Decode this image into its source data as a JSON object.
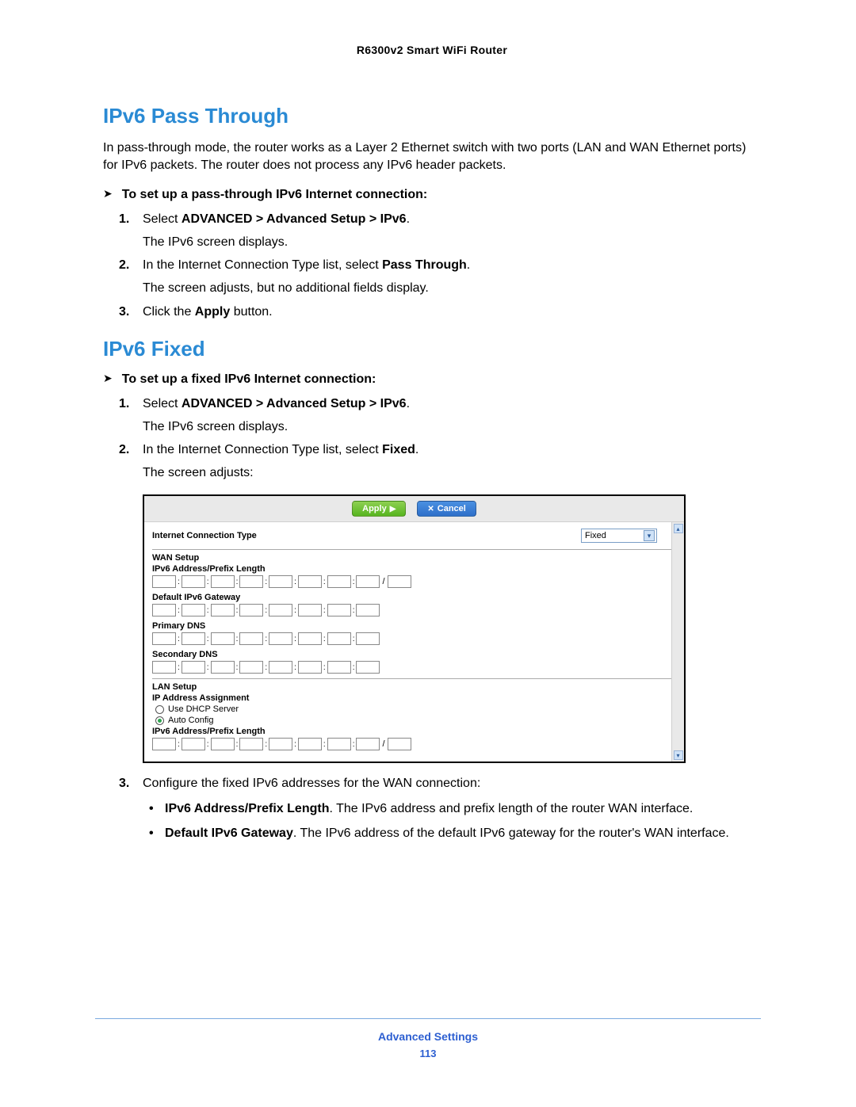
{
  "header": {
    "title": "R6300v2 Smart WiFi Router"
  },
  "sections": {
    "s1_title": "IPv6 Pass Through",
    "s1_body": "In pass-through mode, the router works as a Layer 2 Ethernet switch with two ports (LAN and WAN Ethernet ports) for IPv6 packets. The router does not process any IPv6 header packets.",
    "s1_proc_head": "To set up a pass-through IPv6 Internet connection:",
    "s1_steps": [
      {
        "num": "1.",
        "prefix": "Select ",
        "bold": "ADVANCED > Advanced Setup > IPv6",
        "suffix": ".",
        "sub": "The IPv6 screen displays."
      },
      {
        "num": "2.",
        "prefix": "In the Internet Connection Type list, select ",
        "bold": "Pass Through",
        "suffix": ".",
        "sub": "The screen adjusts, but no additional fields display."
      },
      {
        "num": "3.",
        "prefix": "Click the ",
        "bold": "Apply",
        "suffix": " button.",
        "sub": ""
      }
    ],
    "s2_title": "IPv6 Fixed",
    "s2_proc_head": "To set up a fixed IPv6 Internet connection:",
    "s2_steps": [
      {
        "num": "1.",
        "prefix": "Select ",
        "bold": "ADVANCED > Advanced Setup > IPv6",
        "suffix": ".",
        "sub": "The IPv6 screen displays."
      },
      {
        "num": "2.",
        "prefix": "In the Internet Connection Type list, select ",
        "bold": "Fixed",
        "suffix": ".",
        "sub": "The screen adjusts:"
      }
    ],
    "s2_step3": {
      "num": "3.",
      "text": "Configure the fixed IPv6 addresses for the WAN connection:"
    },
    "s2_bullets": [
      {
        "bold": "IPv6 Address/Prefix Length",
        "text": ". The IPv6 address and prefix length of the router WAN interface."
      },
      {
        "bold": "Default IPv6 Gateway",
        "text": ". The IPv6 address of the default IPv6 gateway for the router's WAN interface."
      }
    ]
  },
  "ui": {
    "apply_label": "Apply",
    "cancel_label": "Cancel",
    "apply_glyph": "▶",
    "cancel_glyph": "✕",
    "conn_label": "Internet Connection Type",
    "conn_value": "Fixed",
    "wan_title": "WAN Setup",
    "wan_addr_label": "IPv6 Address/Prefix Length",
    "gw_label": "Default IPv6 Gateway",
    "pdns_label": "Primary DNS",
    "sdns_label": "Secondary DNS",
    "lan_title": "LAN Setup",
    "ip_assign_label": "IP Address Assignment",
    "radio1": "Use DHCP Server",
    "radio2": "Auto Config",
    "lan_addr_label": "IPv6 Address/Prefix Length"
  },
  "footer": {
    "section": "Advanced Settings",
    "page": "113"
  }
}
